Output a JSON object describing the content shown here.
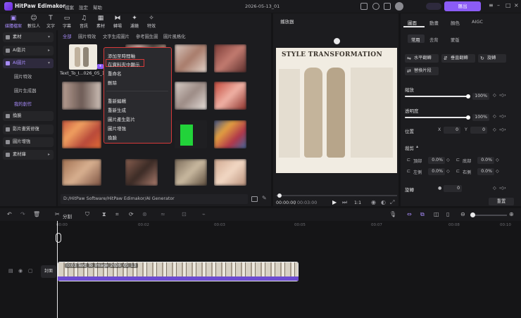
{
  "app": {
    "name": "HitPaw Edimakor",
    "menus": [
      "檔案",
      "設定",
      "幫助"
    ],
    "document_title": "2026-05-13_01",
    "export_label": "匯出"
  },
  "tools": [
    {
      "label": "媒體檔案",
      "icon": "media-icon",
      "active": true
    },
    {
      "label": "數位人",
      "icon": "avatar-icon"
    },
    {
      "label": "文字",
      "icon": "text-icon"
    },
    {
      "label": "字幕",
      "icon": "subtitle-icon"
    },
    {
      "label": "音訊",
      "icon": "audio-icon"
    },
    {
      "label": "素材",
      "icon": "sticker-icon"
    },
    {
      "label": "轉場",
      "icon": "transition-icon"
    },
    {
      "label": "濾鏡",
      "icon": "filter-icon"
    },
    {
      "label": "特效",
      "icon": "effects-icon"
    }
  ],
  "sidebar": {
    "items": [
      {
        "label": "素材"
      },
      {
        "label": "AI影片"
      },
      {
        "label": "AI圖片",
        "active": true
      }
    ],
    "subitems": [
      {
        "label": "圖片特效"
      },
      {
        "label": "圖片生成器"
      },
      {
        "label": "我的創作",
        "active": true
      }
    ],
    "items2": [
      {
        "label": "換臉"
      },
      {
        "label": "影片畫質修復"
      },
      {
        "label": "圖片增強"
      },
      {
        "label": "素材庫"
      }
    ]
  },
  "media": {
    "filters": [
      "全部",
      "圖片特效",
      "文字生成圖片",
      "參考圖生圖",
      "圖片風格化"
    ],
    "first_item_name": "Text_To_I...026_05_13",
    "path": "D:/HitPaw Software/HitPaw Edimakor/AI Generator"
  },
  "context_menu": {
    "items": [
      "添加至時間軸",
      "在資料夾中顯示",
      "重命名",
      "刪除"
    ],
    "items2": [
      "重新編輯",
      "重新生成",
      "圖片產生影片",
      "圖片增強",
      "換臉"
    ],
    "highlighted": "在資料夾中顯示"
  },
  "player": {
    "title": "播放器",
    "preview_heading": "STYLE TRANSFORMATION",
    "time_current": "00:00:00",
    "time_total": "00:03:00",
    "ratio": "1:1"
  },
  "properties": {
    "tabs": [
      "圖面",
      "動畫",
      "顏色",
      "AIGC"
    ],
    "subtabs": [
      "常用",
      "去背",
      "蒙版"
    ],
    "buttons": [
      "水平翻轉",
      "垂直翻轉",
      "旋轉",
      "替換片段"
    ],
    "scale_label": "縮放",
    "scale_value": "100%",
    "scale": 1.0,
    "opacity_label": "透明度",
    "opacity_value": "100%",
    "opacity": 1.0,
    "position_label": "位置",
    "x_label": "X",
    "x_value": "0",
    "y_label": "Y",
    "y_value": "0",
    "crop_label": "裁剪",
    "crop_fields": [
      {
        "label": "頂部",
        "value": "0.0%"
      },
      {
        "label": "底部",
        "value": "0.0%"
      },
      {
        "label": "左側",
        "value": "0.0%"
      },
      {
        "label": "右側",
        "value": "0.0%"
      }
    ],
    "rotate_label": "旋轉",
    "rotate_value": "0",
    "reset_label": "重置"
  },
  "timeline": {
    "split_label": "分割",
    "ruler": [
      "00:00",
      "00:02",
      "00:03",
      "00:05",
      "00:07",
      "00:08",
      "00:10"
    ],
    "track_label": "封面",
    "clip_label": "0:03 Text_To_Image_2026_05_13"
  },
  "colors": {
    "accent": "#8b5cf6",
    "highlight_border": "#d83a3a"
  }
}
